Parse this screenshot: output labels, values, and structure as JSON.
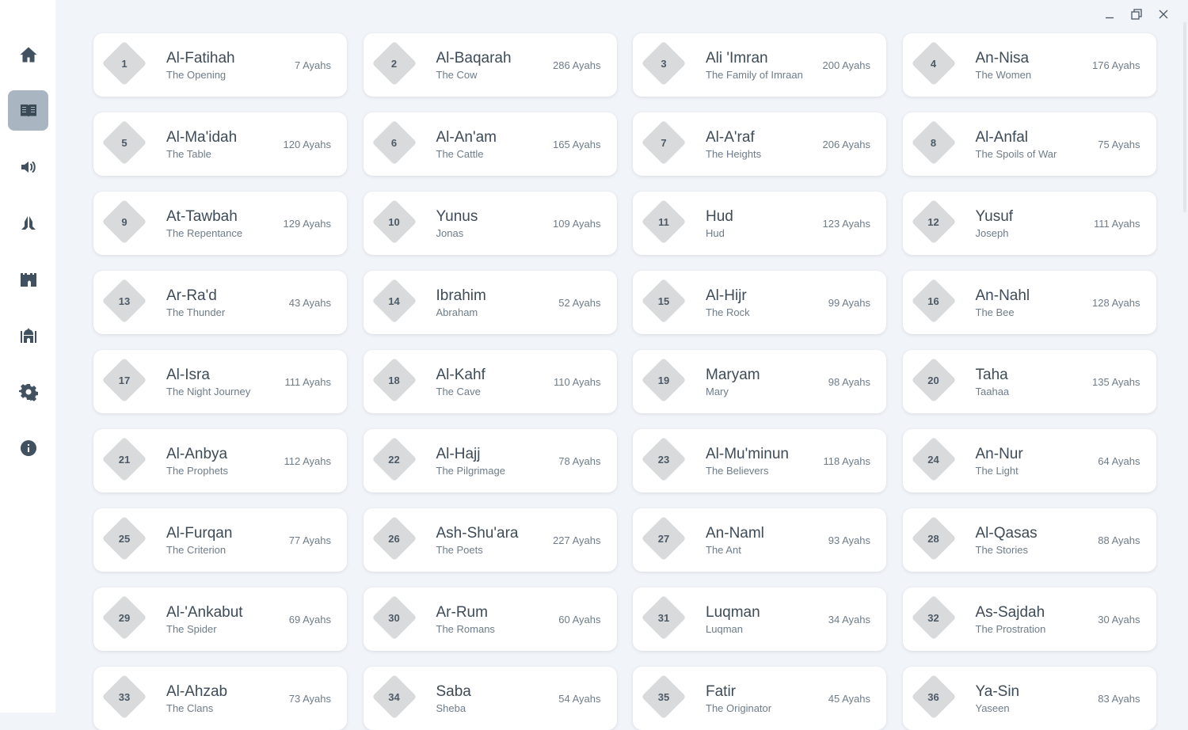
{
  "sidebar": {
    "items": [
      {
        "icon": "home-icon",
        "active": false
      },
      {
        "icon": "quran-book-icon",
        "active": true
      },
      {
        "icon": "audio-speaker-icon",
        "active": false
      },
      {
        "icon": "praying-hands-icon",
        "active": false
      },
      {
        "icon": "castle-icon",
        "active": false
      },
      {
        "icon": "mosque-icon",
        "active": false
      },
      {
        "icon": "gear-icon",
        "active": false
      },
      {
        "icon": "info-icon",
        "active": false
      }
    ]
  },
  "window_controls": [
    "minimize-icon",
    "restore-icon",
    "close-icon"
  ],
  "colors": {
    "accent": "#a9b5c0",
    "background": "#f1f4f8",
    "badge": "#d9dadb"
  },
  "surahs": [
    {
      "number": "1",
      "name": "Al-Fatihah",
      "meaning": "The Opening",
      "ayahs": "7 Ayahs"
    },
    {
      "number": "2",
      "name": "Al-Baqarah",
      "meaning": "The Cow",
      "ayahs": "286 Ayahs"
    },
    {
      "number": "3",
      "name": "Ali 'Imran",
      "meaning": "The Family of Imraan",
      "ayahs": "200 Ayahs"
    },
    {
      "number": "4",
      "name": "An-Nisa",
      "meaning": "The Women",
      "ayahs": "176 Ayahs"
    },
    {
      "number": "5",
      "name": "Al-Ma'idah",
      "meaning": "The Table",
      "ayahs": "120 Ayahs"
    },
    {
      "number": "6",
      "name": "Al-An'am",
      "meaning": "The Cattle",
      "ayahs": "165 Ayahs"
    },
    {
      "number": "7",
      "name": "Al-A'raf",
      "meaning": "The Heights",
      "ayahs": "206 Ayahs"
    },
    {
      "number": "8",
      "name": "Al-Anfal",
      "meaning": "The Spoils of War",
      "ayahs": "75 Ayahs"
    },
    {
      "number": "9",
      "name": "At-Tawbah",
      "meaning": "The Repentance",
      "ayahs": "129 Ayahs"
    },
    {
      "number": "10",
      "name": "Yunus",
      "meaning": "Jonas",
      "ayahs": "109 Ayahs"
    },
    {
      "number": "11",
      "name": "Hud",
      "meaning": "Hud",
      "ayahs": "123 Ayahs"
    },
    {
      "number": "12",
      "name": "Yusuf",
      "meaning": "Joseph",
      "ayahs": "111 Ayahs"
    },
    {
      "number": "13",
      "name": "Ar-Ra'd",
      "meaning": "The Thunder",
      "ayahs": "43 Ayahs"
    },
    {
      "number": "14",
      "name": "Ibrahim",
      "meaning": "Abraham",
      "ayahs": "52 Ayahs"
    },
    {
      "number": "15",
      "name": "Al-Hijr",
      "meaning": "The Rock",
      "ayahs": "99 Ayahs"
    },
    {
      "number": "16",
      "name": "An-Nahl",
      "meaning": "The Bee",
      "ayahs": "128 Ayahs"
    },
    {
      "number": "17",
      "name": "Al-Isra",
      "meaning": "The Night Journey",
      "ayahs": "111 Ayahs"
    },
    {
      "number": "18",
      "name": "Al-Kahf",
      "meaning": "The Cave",
      "ayahs": "110 Ayahs"
    },
    {
      "number": "19",
      "name": "Maryam",
      "meaning": "Mary",
      "ayahs": "98 Ayahs"
    },
    {
      "number": "20",
      "name": "Taha",
      "meaning": "Taahaa",
      "ayahs": "135 Ayahs"
    },
    {
      "number": "21",
      "name": "Al-Anbya",
      "meaning": "The Prophets",
      "ayahs": "112 Ayahs"
    },
    {
      "number": "22",
      "name": "Al-Hajj",
      "meaning": "The Pilgrimage",
      "ayahs": "78 Ayahs"
    },
    {
      "number": "23",
      "name": "Al-Mu'minun",
      "meaning": "The Believers",
      "ayahs": "118 Ayahs"
    },
    {
      "number": "24",
      "name": "An-Nur",
      "meaning": "The Light",
      "ayahs": "64 Ayahs"
    },
    {
      "number": "25",
      "name": "Al-Furqan",
      "meaning": "The Criterion",
      "ayahs": "77 Ayahs"
    },
    {
      "number": "26",
      "name": "Ash-Shu'ara",
      "meaning": "The Poets",
      "ayahs": "227 Ayahs"
    },
    {
      "number": "27",
      "name": "An-Naml",
      "meaning": "The Ant",
      "ayahs": "93 Ayahs"
    },
    {
      "number": "28",
      "name": "Al-Qasas",
      "meaning": "The Stories",
      "ayahs": "88 Ayahs"
    },
    {
      "number": "29",
      "name": "Al-'Ankabut",
      "meaning": "The Spider",
      "ayahs": "69 Ayahs"
    },
    {
      "number": "30",
      "name": "Ar-Rum",
      "meaning": "The Romans",
      "ayahs": "60 Ayahs"
    },
    {
      "number": "31",
      "name": "Luqman",
      "meaning": "Luqman",
      "ayahs": "34 Ayahs"
    },
    {
      "number": "32",
      "name": "As-Sajdah",
      "meaning": "The Prostration",
      "ayahs": "30 Ayahs"
    },
    {
      "number": "33",
      "name": "Al-Ahzab",
      "meaning": "The Clans",
      "ayahs": "73 Ayahs"
    },
    {
      "number": "34",
      "name": "Saba",
      "meaning": "Sheba",
      "ayahs": "54 Ayahs"
    },
    {
      "number": "35",
      "name": "Fatir",
      "meaning": "The Originator",
      "ayahs": "45 Ayahs"
    },
    {
      "number": "36",
      "name": "Ya-Sin",
      "meaning": "Yaseen",
      "ayahs": "83 Ayahs"
    }
  ]
}
